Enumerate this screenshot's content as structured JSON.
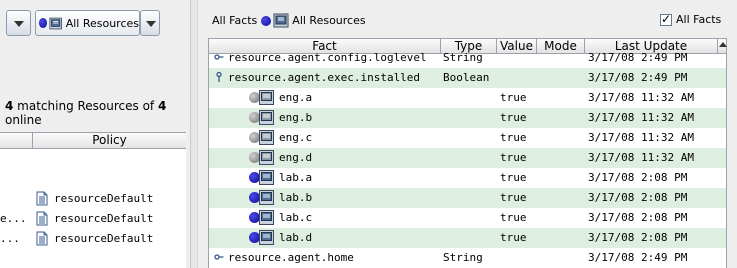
{
  "left_panel": {
    "resource_selector": {
      "label": "All Resources"
    },
    "match": {
      "prefix_count": "4",
      "middle": " matching Resources of ",
      "total": "4",
      "suffix": "online"
    },
    "table": {
      "columns": [
        "",
        "Policy"
      ],
      "rows": [
        {
          "trunc": "",
          "policy": "resourceDefault"
        },
        {
          "trunc": "e...",
          "policy": "resourceDefault"
        },
        {
          "trunc": "...",
          "policy": "resourceDefault"
        }
      ]
    }
  },
  "right_panel": {
    "toolbar": {
      "facts_label": "All Facts",
      "resources_label": "All Resources"
    },
    "filter_checkbox": {
      "label": "All Facts",
      "checked": true
    },
    "grid": {
      "columns": [
        "Fact",
        "Type",
        "Value",
        "Mode",
        "Last Update"
      ],
      "rows": [
        {
          "icon": "key-icon",
          "fact": "resource.agent.config.loglevel",
          "type": "String",
          "value": "",
          "mode": "",
          "updated": "3/17/08 2:49 PM",
          "status": "",
          "alt": false
        },
        {
          "icon": "key-expand-icon",
          "fact": "resource.agent.exec.installed",
          "type": "Boolean",
          "value": "",
          "mode": "",
          "updated": "3/17/08 2:49 PM",
          "status": "",
          "alt": true
        },
        {
          "icon": "",
          "fact": "eng.a",
          "type": "",
          "value": "true",
          "mode": "",
          "updated": "3/17/08 11:32 AM",
          "status": "offline",
          "alt": false
        },
        {
          "icon": "",
          "fact": "eng.b",
          "type": "",
          "value": "true",
          "mode": "",
          "updated": "3/17/08 11:32 AM",
          "status": "offline",
          "alt": true
        },
        {
          "icon": "",
          "fact": "eng.c",
          "type": "",
          "value": "true",
          "mode": "",
          "updated": "3/17/08 11:32 AM",
          "status": "offline",
          "alt": false
        },
        {
          "icon": "",
          "fact": "eng.d",
          "type": "",
          "value": "true",
          "mode": "",
          "updated": "3/17/08 11:32 AM",
          "status": "offline",
          "alt": true
        },
        {
          "icon": "",
          "fact": "lab.a",
          "type": "",
          "value": "true",
          "mode": "",
          "updated": "3/17/08 2:08 PM",
          "status": "online",
          "alt": false
        },
        {
          "icon": "",
          "fact": "lab.b",
          "type": "",
          "value": "true",
          "mode": "",
          "updated": "3/17/08 2:08 PM",
          "status": "online",
          "alt": true
        },
        {
          "icon": "",
          "fact": "lab.c",
          "type": "",
          "value": "true",
          "mode": "",
          "updated": "3/17/08 2:08 PM",
          "status": "online",
          "alt": false
        },
        {
          "icon": "",
          "fact": "lab.d",
          "type": "",
          "value": "true",
          "mode": "",
          "updated": "3/17/08 2:08 PM",
          "status": "online",
          "alt": true
        },
        {
          "icon": "key-icon",
          "fact": "resource.agent.home",
          "type": "String",
          "value": "",
          "mode": "",
          "updated": "3/17/08 2:49 PM",
          "status": "",
          "alt": false
        }
      ]
    }
  },
  "colors": {
    "row_alt": "#deefe2",
    "online": "#0a0a9a",
    "offline": "#808080"
  }
}
